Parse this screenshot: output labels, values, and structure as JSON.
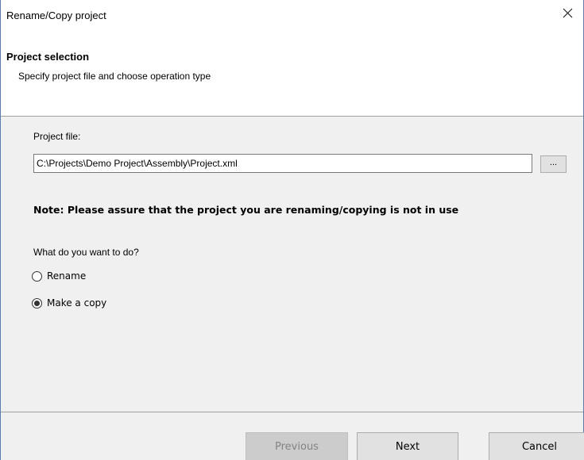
{
  "window": {
    "title": "Rename/Copy project",
    "close_icon": "close-icon"
  },
  "header": {
    "title": "Project selection",
    "subtitle": "Specify project file and choose operation type"
  },
  "form": {
    "project_file_label": "Project file:",
    "project_file_value": "C:\\Projects\\Demo Project\\Assembly\\Project.xml",
    "browse_label": "...",
    "note": "Note: Please assure that the project you are renaming/copying is not in use",
    "question": "What do you want to do?",
    "options": [
      {
        "label": "Rename",
        "checked": false
      },
      {
        "label": "Make a copy",
        "checked": true
      }
    ]
  },
  "footer": {
    "previous_label": "Previous",
    "previous_enabled": false,
    "next_label": "Next",
    "cancel_label": "Cancel"
  }
}
